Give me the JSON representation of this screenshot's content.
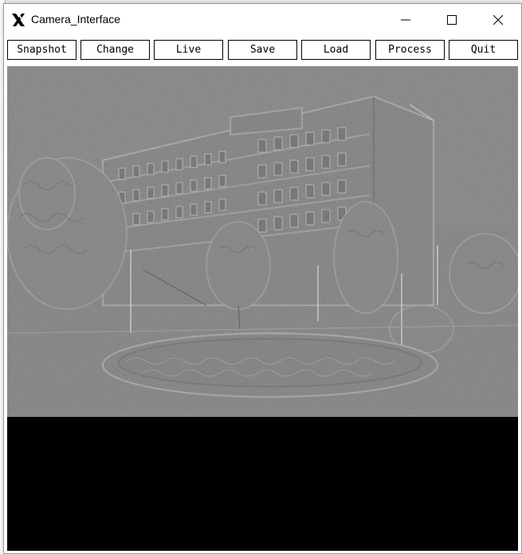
{
  "window": {
    "title": "Camera_Interface",
    "app_icon": "x11-icon",
    "controls": [
      "minimize-icon",
      "maximize-icon",
      "close-icon"
    ]
  },
  "toolbar": {
    "buttons": [
      "Snapshot",
      "Change",
      "Live",
      "Save",
      "Load",
      "Process",
      "Quit"
    ]
  },
  "view": {
    "image": "embossed grayscale photo of a multi-story building with trees",
    "colors": {
      "image_background": "#7f7f7f",
      "lower_area": "#000000"
    }
  }
}
